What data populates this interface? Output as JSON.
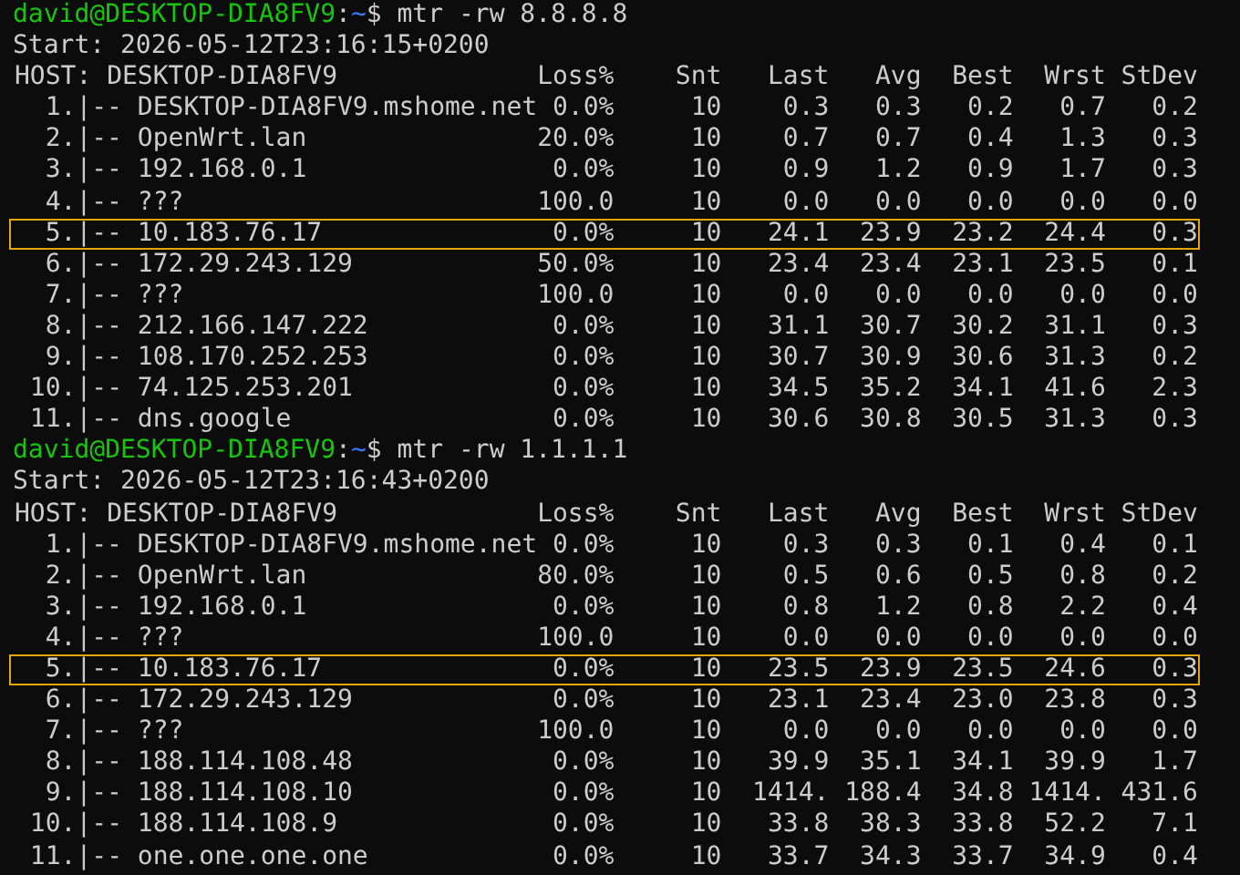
{
  "runs": [
    {
      "prompt": [
        {
          "kind": "user",
          "text": "david@DESKTOP-DIA8FV9"
        },
        {
          "kind": "plain",
          "text": ":"
        },
        {
          "kind": "path",
          "text": "~"
        },
        {
          "kind": "plain",
          "text": "$ mtr -rw 8.8.8.8"
        }
      ],
      "start": "Start: 2026-05-12T23:16:15+0200",
      "host_label": "HOST: DESKTOP-DIA8FV9",
      "columns": [
        "Loss%",
        "Snt",
        "Last",
        "Avg",
        "Best",
        "Wrst",
        "StDev"
      ],
      "hops": [
        {
          "hop": "1.|--",
          "host": "DESKTOP-DIA8FV9.mshome.net",
          "values": [
            "0.0%",
            "10",
            "0.3",
            "0.3",
            "0.2",
            "0.7",
            "0.2"
          ],
          "highlighted": false
        },
        {
          "hop": "2.|--",
          "host": "OpenWrt.lan",
          "values": [
            "20.0%",
            "10",
            "0.7",
            "0.7",
            "0.4",
            "1.3",
            "0.3"
          ],
          "highlighted": false
        },
        {
          "hop": "3.|--",
          "host": "192.168.0.1",
          "values": [
            "0.0%",
            "10",
            "0.9",
            "1.2",
            "0.9",
            "1.7",
            "0.3"
          ],
          "highlighted": false
        },
        {
          "hop": "4.|--",
          "host": "???",
          "values": [
            "100.0",
            "10",
            "0.0",
            "0.0",
            "0.0",
            "0.0",
            "0.0"
          ],
          "highlighted": false
        },
        {
          "hop": "5.|--",
          "host": "10.183.76.17",
          "values": [
            "0.0%",
            "10",
            "24.1",
            "23.9",
            "23.2",
            "24.4",
            "0.3"
          ],
          "highlighted": true
        },
        {
          "hop": "6.|--",
          "host": "172.29.243.129",
          "values": [
            "50.0%",
            "10",
            "23.4",
            "23.4",
            "23.1",
            "23.5",
            "0.1"
          ],
          "highlighted": false
        },
        {
          "hop": "7.|--",
          "host": "???",
          "values": [
            "100.0",
            "10",
            "0.0",
            "0.0",
            "0.0",
            "0.0",
            "0.0"
          ],
          "highlighted": false
        },
        {
          "hop": "8.|--",
          "host": "212.166.147.222",
          "values": [
            "0.0%",
            "10",
            "31.1",
            "30.7",
            "30.2",
            "31.1",
            "0.3"
          ],
          "highlighted": false
        },
        {
          "hop": "9.|--",
          "host": "108.170.252.253",
          "values": [
            "0.0%",
            "10",
            "30.7",
            "30.9",
            "30.6",
            "31.3",
            "0.2"
          ],
          "highlighted": false
        },
        {
          "hop": "10.|--",
          "host": "74.125.253.201",
          "values": [
            "0.0%",
            "10",
            "34.5",
            "35.2",
            "34.1",
            "41.6",
            "2.3"
          ],
          "highlighted": false
        },
        {
          "hop": "11.|--",
          "host": "dns.google",
          "values": [
            "0.0%",
            "10",
            "30.6",
            "30.8",
            "30.5",
            "31.3",
            "0.3"
          ],
          "highlighted": false
        }
      ]
    },
    {
      "prompt": [
        {
          "kind": "user",
          "text": "david@DESKTOP-DIA8FV9"
        },
        {
          "kind": "plain",
          "text": ":"
        },
        {
          "kind": "path",
          "text": "~"
        },
        {
          "kind": "plain",
          "text": "$ mtr -rw 1.1.1.1"
        }
      ],
      "start": "Start: 2026-05-12T23:16:43+0200",
      "host_label": "HOST: DESKTOP-DIA8FV9",
      "columns": [
        "Loss%",
        "Snt",
        "Last",
        "Avg",
        "Best",
        "Wrst",
        "StDev"
      ],
      "hops": [
        {
          "hop": "1.|--",
          "host": "DESKTOP-DIA8FV9.mshome.net",
          "values": [
            "0.0%",
            "10",
            "0.3",
            "0.3",
            "0.1",
            "0.4",
            "0.1"
          ],
          "highlighted": false
        },
        {
          "hop": "2.|--",
          "host": "OpenWrt.lan",
          "values": [
            "80.0%",
            "10",
            "0.5",
            "0.6",
            "0.5",
            "0.8",
            "0.2"
          ],
          "highlighted": false
        },
        {
          "hop": "3.|--",
          "host": "192.168.0.1",
          "values": [
            "0.0%",
            "10",
            "0.8",
            "1.2",
            "0.8",
            "2.2",
            "0.4"
          ],
          "highlighted": false
        },
        {
          "hop": "4.|--",
          "host": "???",
          "values": [
            "100.0",
            "10",
            "0.0",
            "0.0",
            "0.0",
            "0.0",
            "0.0"
          ],
          "highlighted": false
        },
        {
          "hop": "5.|--",
          "host": "10.183.76.17",
          "values": [
            "0.0%",
            "10",
            "23.5",
            "23.9",
            "23.5",
            "24.6",
            "0.3"
          ],
          "highlighted": true
        },
        {
          "hop": "6.|--",
          "host": "172.29.243.129",
          "values": [
            "0.0%",
            "10",
            "23.1",
            "23.4",
            "23.0",
            "23.8",
            "0.3"
          ],
          "highlighted": false
        },
        {
          "hop": "7.|--",
          "host": "???",
          "values": [
            "100.0",
            "10",
            "0.0",
            "0.0",
            "0.0",
            "0.0",
            "0.0"
          ],
          "highlighted": false
        },
        {
          "hop": "8.|--",
          "host": "188.114.108.48",
          "values": [
            "0.0%",
            "10",
            "39.9",
            "35.1",
            "34.1",
            "39.9",
            "1.7"
          ],
          "highlighted": false
        },
        {
          "hop": "9.|--",
          "host": "188.114.108.10",
          "values": [
            "0.0%",
            "10",
            "1414.",
            "188.4",
            "34.8",
            "1414.",
            "431.6"
          ],
          "highlighted": false
        },
        {
          "hop": "10.|--",
          "host": "188.114.108.9",
          "values": [
            "0.0%",
            "10",
            "33.8",
            "38.3",
            "33.8",
            "52.2",
            "7.1"
          ],
          "highlighted": false
        },
        {
          "hop": "11.|--",
          "host": "one.one.one.one",
          "values": [
            "0.0%",
            "10",
            "33.7",
            "34.3",
            "33.7",
            "34.9",
            "0.4"
          ],
          "highlighted": false
        }
      ]
    }
  ]
}
